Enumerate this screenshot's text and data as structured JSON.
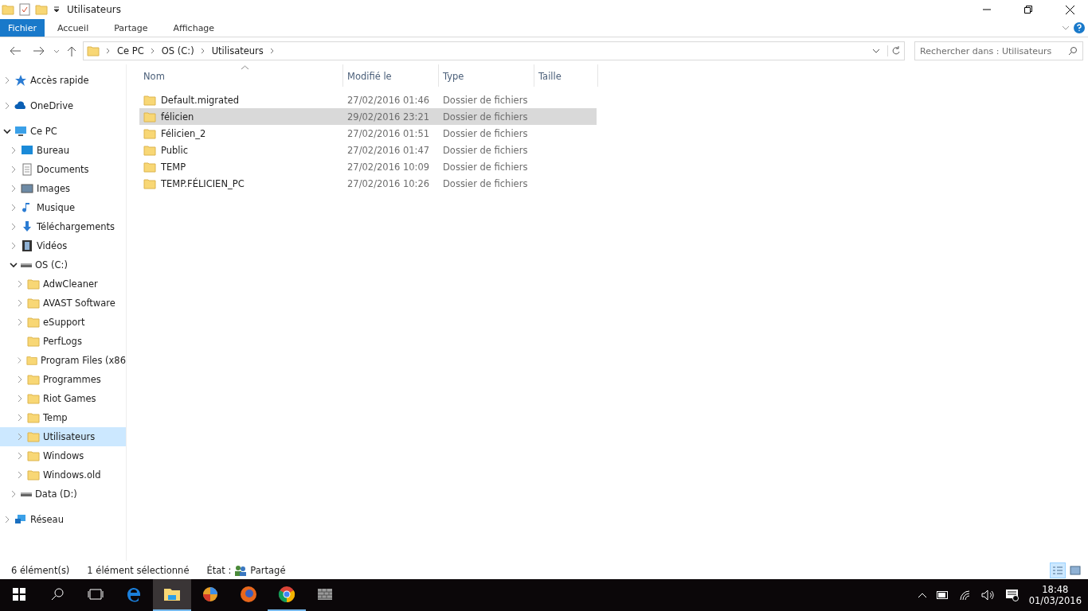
{
  "window": {
    "title": "Utilisateurs"
  },
  "ribbon_tabs": [
    {
      "label": "Fichier",
      "kind": "file"
    },
    {
      "label": "Accueil",
      "kind": "tab"
    },
    {
      "label": "Partage",
      "kind": "tab"
    },
    {
      "label": "Affichage",
      "kind": "tab"
    }
  ],
  "address_bar": {
    "crumbs": [
      "Ce PC",
      "OS (C:)",
      "Utilisateurs"
    ]
  },
  "search": {
    "placeholder": "Rechercher dans : Utilisateurs"
  },
  "sidebar": {
    "items": [
      {
        "label": "Accès rapide",
        "kind": "star",
        "expanded": false,
        "selected": false
      },
      {
        "label": "OneDrive",
        "kind": "cloud",
        "expanded": false,
        "selected": false
      },
      {
        "label": "Ce PC",
        "kind": "pc",
        "expanded": true,
        "selected": false,
        "children": [
          {
            "label": "Bureau",
            "kind": "desktop",
            "expanded": false,
            "selected": false
          },
          {
            "label": "Documents",
            "kind": "documents",
            "expanded": false,
            "selected": false
          },
          {
            "label": "Images",
            "kind": "images",
            "expanded": false,
            "selected": false
          },
          {
            "label": "Musique",
            "kind": "music",
            "expanded": false,
            "selected": false
          },
          {
            "label": "Téléchargements",
            "kind": "download",
            "expanded": false,
            "selected": false
          },
          {
            "label": "Vidéos",
            "kind": "video",
            "expanded": false,
            "selected": false
          },
          {
            "label": "OS (C:)",
            "kind": "drive",
            "expanded": true,
            "selected": false,
            "children": [
              {
                "label": "AdwCleaner",
                "kind": "folder",
                "expanded": false,
                "selected": false
              },
              {
                "label": "AVAST Software",
                "kind": "folder",
                "expanded": false,
                "selected": false
              },
              {
                "label": "eSupport",
                "kind": "folder",
                "expanded": false,
                "selected": false
              },
              {
                "label": "PerfLogs",
                "kind": "folder",
                "selected": false
              },
              {
                "label": "Program Files (x86",
                "kind": "folder",
                "expanded": false,
                "selected": false
              },
              {
                "label": "Programmes",
                "kind": "folder",
                "expanded": false,
                "selected": false
              },
              {
                "label": "Riot Games",
                "kind": "folder",
                "expanded": false,
                "selected": false
              },
              {
                "label": "Temp",
                "kind": "folder",
                "expanded": false,
                "selected": false
              },
              {
                "label": "Utilisateurs",
                "kind": "folder",
                "expanded": false,
                "selected": true
              },
              {
                "label": "Windows",
                "kind": "folder",
                "expanded": false,
                "selected": false
              },
              {
                "label": "Windows.old",
                "kind": "folder",
                "expanded": false,
                "selected": false
              }
            ]
          },
          {
            "label": "Data (D:)",
            "kind": "drive",
            "expanded": false,
            "selected": false
          }
        ]
      },
      {
        "label": "Réseau",
        "kind": "network",
        "expanded": false,
        "selected": false
      }
    ]
  },
  "file_list": {
    "columns": [
      {
        "label": "Nom",
        "sorted": true
      },
      {
        "label": "Modifié le",
        "sorted": false
      },
      {
        "label": "Type",
        "sorted": false
      },
      {
        "label": "Taille",
        "sorted": false
      }
    ],
    "rows": [
      {
        "name": "Default.migrated",
        "modified": "27/02/2016 01:46",
        "type": "Dossier de fichiers",
        "selected": false
      },
      {
        "name": "félicien",
        "modified": "29/02/2016 23:21",
        "type": "Dossier de fichiers",
        "selected": true
      },
      {
        "name": "Félicien_2",
        "modified": "27/02/2016 01:51",
        "type": "Dossier de fichiers",
        "selected": false
      },
      {
        "name": "Public",
        "modified": "27/02/2016 01:47",
        "type": "Dossier de fichiers",
        "selected": false
      },
      {
        "name": "TEMP",
        "modified": "27/02/2016 10:09",
        "type": "Dossier de fichiers",
        "selected": false
      },
      {
        "name": "TEMP.FÉLICIEN_PC",
        "modified": "27/02/2016 10:26",
        "type": "Dossier de fichiers",
        "selected": false
      }
    ]
  },
  "status_bar": {
    "count": "6 élément(s)",
    "selection": "1 élément sélectionné",
    "state_label": "État :",
    "state_value": "Partagé"
  },
  "view_buttons": [
    {
      "kind": "details",
      "selected": true
    },
    {
      "kind": "large",
      "selected": false
    }
  ],
  "taskbar": {
    "apps": [
      {
        "kind": "edge",
        "running": false,
        "active": false
      },
      {
        "kind": "explorer",
        "running": true,
        "active": true
      },
      {
        "kind": "swirl",
        "running": false,
        "active": false
      },
      {
        "kind": "firefox",
        "running": false,
        "active": false
      },
      {
        "kind": "chrome",
        "running": true,
        "active": false
      },
      {
        "kind": "wall",
        "running": false,
        "active": false
      }
    ],
    "time": "18:48",
    "date": "01/03/2016"
  }
}
